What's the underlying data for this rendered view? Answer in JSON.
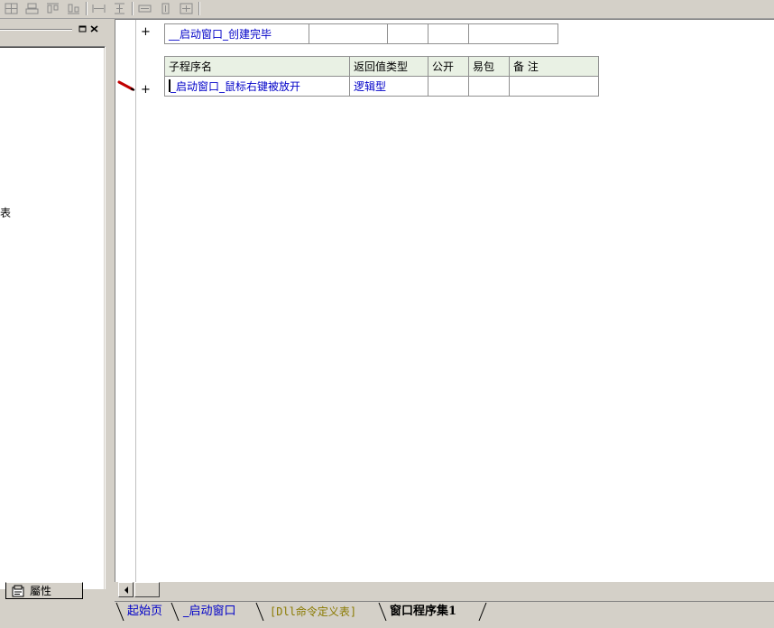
{
  "left_panel": {
    "partial_item": "表",
    "tab_label": "屬性"
  },
  "editor": {
    "row1": {
      "sub_name": "__启动窗口_创建完毕"
    },
    "table2": {
      "headers": [
        "子程序名",
        "返回值类型",
        "公开",
        "易包",
        "备 注"
      ],
      "row": {
        "name": "_启动窗口_鼠标右键被放开",
        "return_type": "逻辑型"
      }
    }
  },
  "tabs": [
    {
      "label": "起始页"
    },
    {
      "label": "_启动窗口"
    },
    {
      "label": "[Dll命令定义表]"
    },
    {
      "label": "窗口程序集1"
    }
  ],
  "colors": {
    "link_blue": "#0000c8",
    "olive_tab": "#8a7a00",
    "header_bg": "#e9f1e4"
  }
}
